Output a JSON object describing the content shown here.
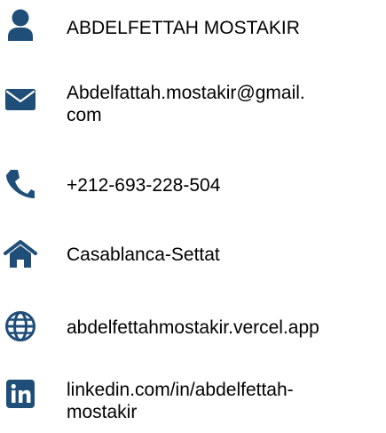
{
  "contact": {
    "name": "ABDELFETTAH MOSTAKIR",
    "email_line1": "Abdelfattah.mostakir@gmail.",
    "email_line2": "com",
    "phone": "+212-693-228-504",
    "location": "Casablanca-Settat",
    "website": "abdelfettahmostakir.vercel.app",
    "linkedin_line1": "linkedin.com/in/abdelfettah-",
    "linkedin_line2": "mostakir"
  },
  "icons": {
    "name": "user-icon",
    "email": "envelope-icon",
    "phone": "phone-icon",
    "location": "home-icon",
    "website": "globe-icon",
    "linkedin": "linkedin-icon"
  },
  "colors": {
    "icon": "#1f4e79",
    "text": "#000000",
    "background": "#ffffff"
  }
}
